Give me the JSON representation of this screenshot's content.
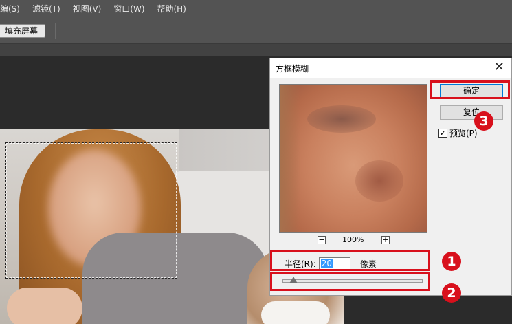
{
  "menubar": {
    "items": [
      "编(S)",
      "滤镜(T)",
      "视图(V)",
      "窗口(W)",
      "帮助(H)"
    ]
  },
  "options": {
    "fill_screen_label": "填充屏幕"
  },
  "dialog": {
    "title": "方框模糊",
    "close_glyph": "✕",
    "ok_label": "确定",
    "reset_label": "复位",
    "preview_label": "预览(P)",
    "preview_checked": true,
    "zoom": {
      "minus": "−",
      "plus": "+",
      "percent": "100%"
    },
    "radius": {
      "label": "半径(R):",
      "value": "20",
      "unit": "像素"
    },
    "slider_fraction": 0.08
  },
  "annotations": {
    "step1": "1",
    "step2": "2",
    "step3": "3"
  },
  "colors": {
    "highlight": "#d8101c",
    "menubar": "#535353",
    "canvas": "#2b2b2b"
  }
}
